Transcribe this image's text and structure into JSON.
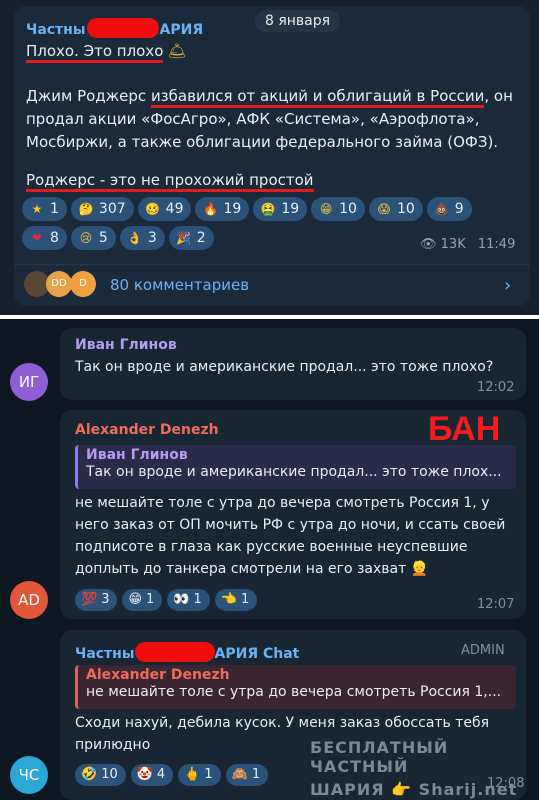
{
  "post": {
    "date": "8 января",
    "channel_prefix": "Частны",
    "channel_suffix": "АРИЯ",
    "line1": "Плохо. Это плохо",
    "p2_a": "Джим Роджерс ",
    "p2_b": "избавился от акций и облигаций в России",
    "p2_c": ", он",
    "p2_line2": "продал акции «ФосАгро», АФК «Система», «Аэрофлота»,",
    "p2_line3": "Мосбиржи, а также облигации федерального займа (ОФЗ).",
    "line4": "Роджерс - это не прохожий простой",
    "reactions_row1": [
      {
        "icon": "star-icon",
        "count": "1",
        "color": "#f5c518",
        "glyph": "★"
      },
      {
        "icon": "thinking-emoji-icon",
        "count": "307",
        "color": "#f3c13a",
        "glyph": "🤔"
      },
      {
        "icon": "woozy-emoji-icon",
        "count": "49",
        "color": "#f3c13a",
        "glyph": "🥴"
      },
      {
        "icon": "fire-emoji-icon",
        "count": "19",
        "color": "#ff7a1a",
        "glyph": "🔥"
      },
      {
        "icon": "vomit-emoji-icon",
        "count": "19",
        "color": "#6cc04a",
        "glyph": "🤮"
      },
      {
        "icon": "grin-emoji-icon",
        "count": "10",
        "color": "#f3c13a",
        "glyph": "😁"
      },
      {
        "icon": "scream-emoji-icon",
        "count": "10",
        "color": "#f3c13a",
        "glyph": "😱"
      },
      {
        "icon": "poop-emoji-icon",
        "count": "9",
        "color": "#8b5a2b",
        "glyph": "💩"
      }
    ],
    "reactions_row2": [
      {
        "icon": "heart-emoji-icon",
        "count": "8",
        "color": "#e4283a",
        "glyph": "❤"
      },
      {
        "icon": "crying-emoji-icon",
        "count": "5",
        "color": "#f3c13a",
        "glyph": "😢"
      },
      {
        "icon": "ok-hand-emoji-icon",
        "count": "3",
        "color": "#f3c13a",
        "glyph": "👌"
      },
      {
        "icon": "party-emoji-icon",
        "count": "2",
        "color": "#e0a030",
        "glyph": "🎉"
      }
    ],
    "views": "13K",
    "time": "11:49",
    "comments": "80 комментариев",
    "comment_avatars": [
      "DD",
      "D"
    ]
  },
  "comments": [
    {
      "initials": "ИГ",
      "avatar_color": "#8f5ed6",
      "name": "Иван Глинов",
      "name_color": "#b79cf0",
      "text": "Так он вроде и американские продал... это тоже плохо?",
      "time": "12:02"
    },
    {
      "initials": "AD",
      "avatar_color": "#e2573a",
      "name": "Alexander Denezh",
      "name_color": "#ef6c5b",
      "ban": "БАН",
      "quote_name": "Иван Глинов",
      "quote_text": "Так он вроде и американские продал... это тоже плох...",
      "text_lines": [
        "не мешайте толе с утра до вечера смотреть Россия 1, у",
        "него заказ от ОП мочить РФ с утра до ночи, и ссать своей",
        "подписоте в глаза как русские военные неуспевшие",
        "доплыть до танкера смотрели на его захват"
      ],
      "reactions": [
        {
          "icon": "hundred-emoji-icon",
          "count": "3",
          "glyph": "💯"
        },
        {
          "icon": "grin-emoji-icon",
          "count": "1",
          "glyph": "😁"
        },
        {
          "icon": "eyes-emoji-icon",
          "count": "1",
          "glyph": "👀"
        },
        {
          "icon": "pointing-emoji-icon",
          "count": "1",
          "glyph": "👈"
        }
      ],
      "time": "12:07"
    },
    {
      "initials": "ЧС",
      "avatar_color": "#2aa7d4",
      "name_prefix": "Частны",
      "name_suffix": "АРИЯ Chat",
      "name_color": "#6ab3f3",
      "badge": "ADMIN",
      "quote_name": "Alexander Denezh",
      "quote_text": "не мешайте толе с утра до вечера смотреть Россия 1,...",
      "text_lines": [
        "Сходи нахуй, дебила кусок. У меня заказ обоссать тебя",
        "прилюдно"
      ],
      "reactions": [
        {
          "icon": "rofl-emoji-icon",
          "count": "10",
          "glyph": "🤣"
        },
        {
          "icon": "clown-emoji-icon",
          "count": "4",
          "glyph": "🤡"
        },
        {
          "icon": "middle-finger-emoji-icon",
          "count": "1",
          "glyph": "🖕"
        },
        {
          "icon": "monkey-emoji-icon",
          "count": "1",
          "glyph": "🙈"
        }
      ],
      "time": "12:08"
    }
  ],
  "watermark": {
    "line1": "БЕСПЛАТНЫЙ ЧАСТНЫЙ",
    "line2": "ШАРИЯ",
    "line2b": "Sharij.net"
  }
}
